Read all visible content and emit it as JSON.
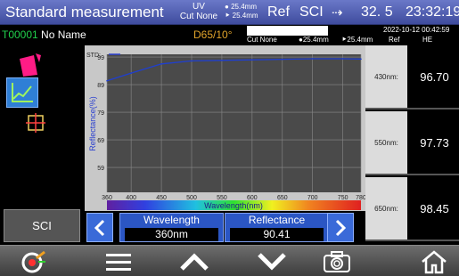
{
  "header": {
    "title": "Standard measurement",
    "uv_line1": "UV",
    "uv_line2": "Cut None",
    "aperture_line1": "25.4mm",
    "aperture_line2": "25.4mm",
    "ref": "Ref",
    "sci": "SCI",
    "battery": "32. 5",
    "time": "23:32:19"
  },
  "info": {
    "sample_id": "T00001",
    "sample_name": "No Name",
    "illuminant": "D65/10°",
    "uv_mode": "Cut None",
    "aperture_a": "25.4mm",
    "aperture_b": "25.4mm",
    "datetime": "2022-10-12  00:42:59",
    "col_ref": "Ref",
    "col_de": "ΗE"
  },
  "sidebar": {
    "mode_button": "SCI"
  },
  "chart_data": {
    "type": "line",
    "std_label": "STD:",
    "ylabel": "Reflectance(%)",
    "xlabel": "Wavelength(nm)",
    "x_ticks": [
      "360",
      "400",
      "450",
      "500",
      "550",
      "600",
      "650",
      "700",
      "750",
      "780"
    ],
    "y_ticks": [
      "99",
      "89",
      "79",
      "69",
      "59"
    ],
    "xlim": [
      360,
      780
    ],
    "ylim": [
      50,
      100
    ],
    "grid": true,
    "series": [
      {
        "color": "#1f3fd0",
        "x": [
          360,
          400,
          450,
          500,
          550,
          600,
          650,
          700,
          750,
          780
        ],
        "y": [
          90.4,
          93.2,
          96.5,
          97.6,
          97.8,
          98.0,
          98.2,
          98.4,
          98.4,
          98.3
        ]
      }
    ]
  },
  "readings": [
    {
      "wavelength": "430nm:",
      "value": "96.70"
    },
    {
      "wavelength": "550nm:",
      "value": "97.73"
    },
    {
      "wavelength": "650nm:",
      "value": "98.45"
    }
  ],
  "nav": {
    "wavelength_label": "Wavelength",
    "wavelength_value": "360nm",
    "reflectance_label": "Reflectance",
    "reflectance_value": "90.41"
  },
  "toolbar": {
    "icons": [
      "target-icon",
      "menu-icon",
      "up-icon",
      "down-icon",
      "camera-icon",
      "home-icon"
    ]
  }
}
